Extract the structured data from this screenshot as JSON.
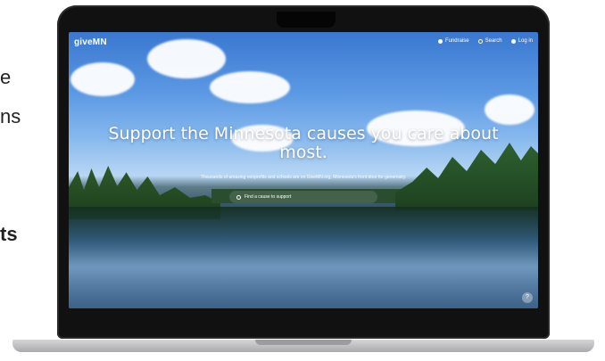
{
  "slide_fragments": {
    "left_e": "e",
    "left_ns": "ns",
    "left_ts": "ts"
  },
  "site": {
    "logo": "giveMN",
    "nav": [
      {
        "label": "Fundraise",
        "icon": "gear-icon"
      },
      {
        "label": "Search",
        "icon": "search-icon"
      },
      {
        "label": "Log in",
        "icon": "user-icon"
      }
    ],
    "hero_title": "Support the Minnesota causes you care about most.",
    "hero_subtitle": "Thousands of amazing nonprofits and schools are on GiveMN.org, Minnesota's front door for generosity.",
    "search_placeholder": "Find a cause to support",
    "help_label": "?"
  }
}
